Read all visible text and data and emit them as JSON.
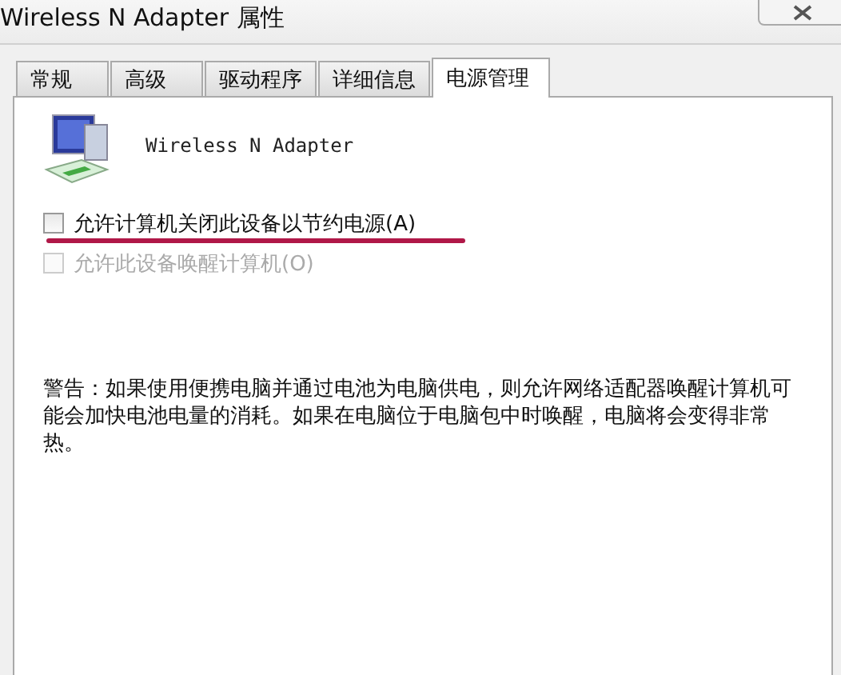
{
  "window": {
    "title": "Wireless N Adapter 属性"
  },
  "tabs": [
    {
      "label": "常规",
      "selected": false
    },
    {
      "label": "高级",
      "selected": false
    },
    {
      "label": "驱动程序",
      "selected": false
    },
    {
      "label": "详细信息",
      "selected": false
    },
    {
      "label": "电源管理",
      "selected": true
    }
  ],
  "device": {
    "name": "Wireless N Adapter"
  },
  "options": [
    {
      "label": "允许计算机关闭此设备以节约电源(A)",
      "checked": false,
      "disabled": false,
      "highlighted": true
    },
    {
      "label": "允许此设备唤醒计算机(O)",
      "checked": false,
      "disabled": true,
      "highlighted": false
    }
  ],
  "warning": "警告：如果使用便携电脑并通过电池为电脑供电，则允许网络适配器唤醒计算机可能会加快电池电量的消耗。如果在电脑位于电脑包中时唤醒，电脑将会变得非常热。"
}
